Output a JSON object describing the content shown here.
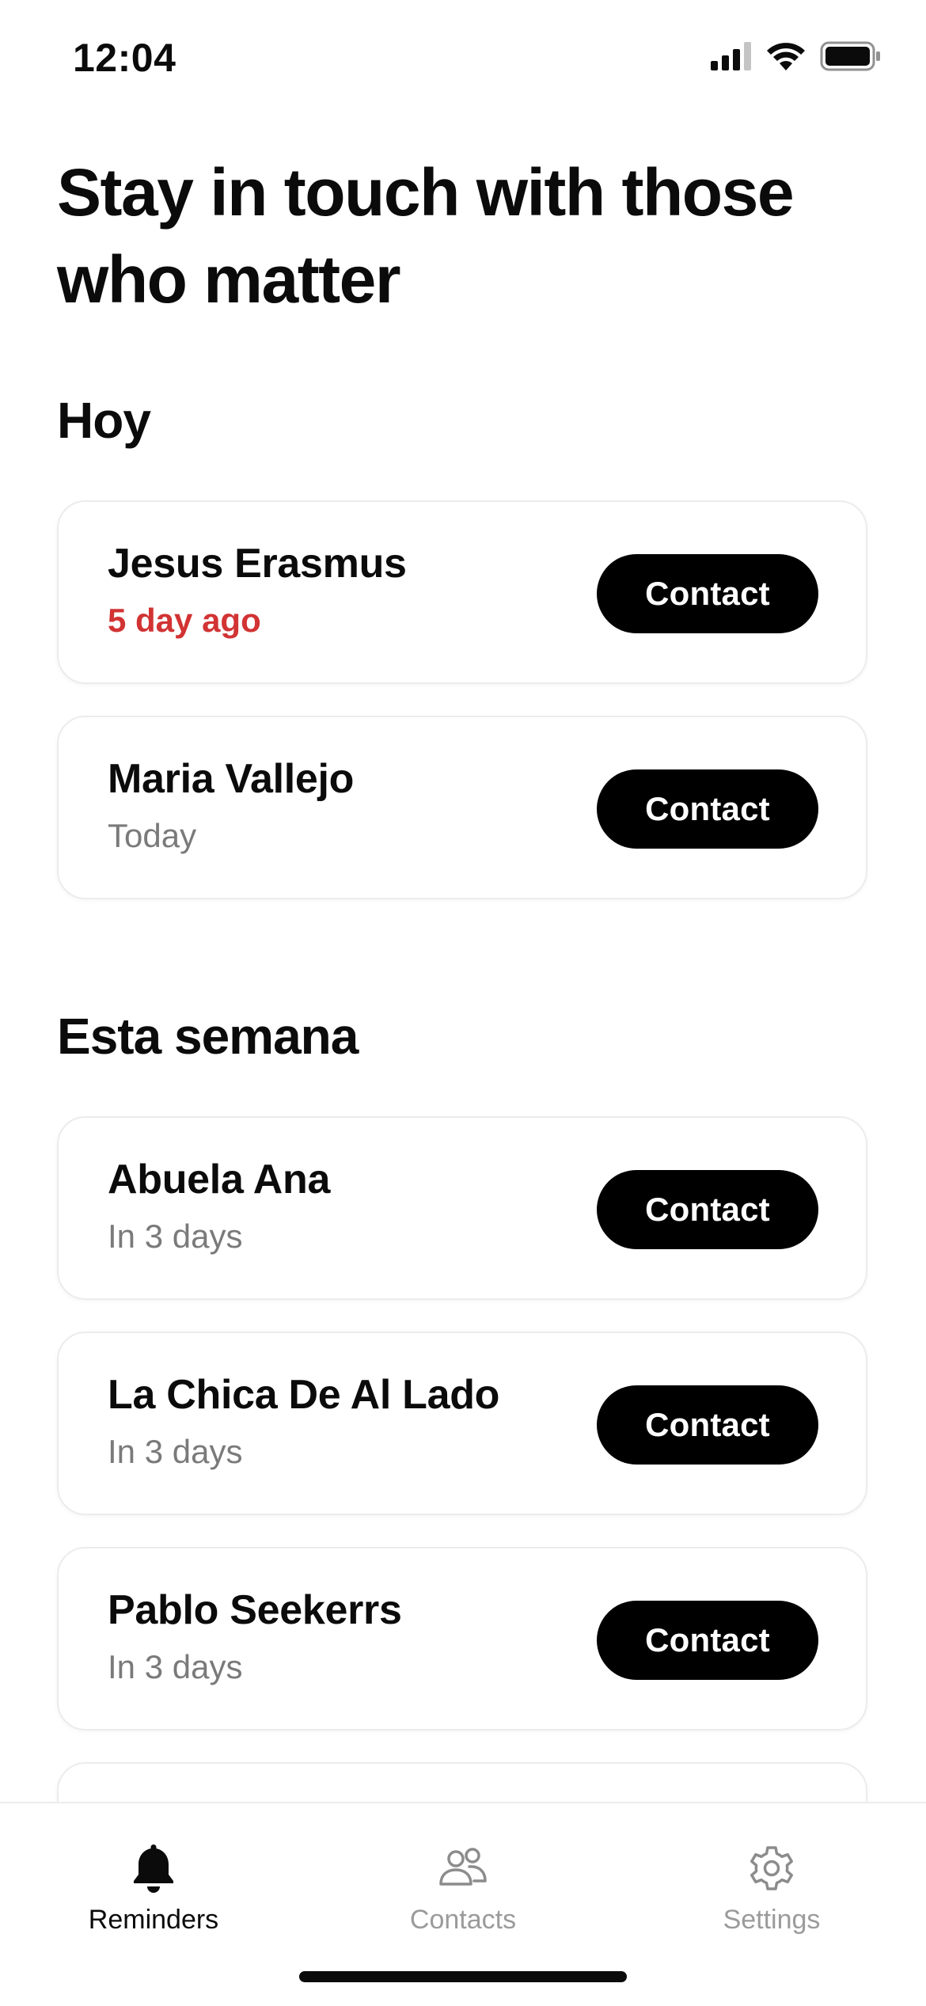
{
  "status_bar": {
    "time": "12:04"
  },
  "title": "Stay in touch with those who matter",
  "sections": [
    {
      "title": "Hoy",
      "items": [
        {
          "name": "Jesus Erasmus",
          "status": "5 day ago",
          "overdue": true,
          "button": "Contact"
        },
        {
          "name": "Maria Vallejo",
          "status": "Today",
          "overdue": false,
          "button": "Contact"
        }
      ]
    },
    {
      "title": "Esta semana",
      "items": [
        {
          "name": "Abuela Ana",
          "status": "In 3 days",
          "overdue": false,
          "button": "Contact"
        },
        {
          "name": "La Chica De Al Lado",
          "status": "In 3 days",
          "overdue": false,
          "button": "Contact"
        },
        {
          "name": "Pablo Seekerrs",
          "status": "In 3 days",
          "overdue": false,
          "button": "Contact"
        }
      ]
    }
  ],
  "tabs": [
    {
      "label": "Reminders",
      "icon": "bell-icon",
      "active": true
    },
    {
      "label": "Contacts",
      "icon": "people-icon",
      "active": false
    },
    {
      "label": "Settings",
      "icon": "gear-icon",
      "active": false
    }
  ],
  "colors": {
    "overdue": "#d23333",
    "button_bg": "#000000",
    "muted_text": "#7a7a7a",
    "inactive_tab": "#9b9b9b"
  }
}
